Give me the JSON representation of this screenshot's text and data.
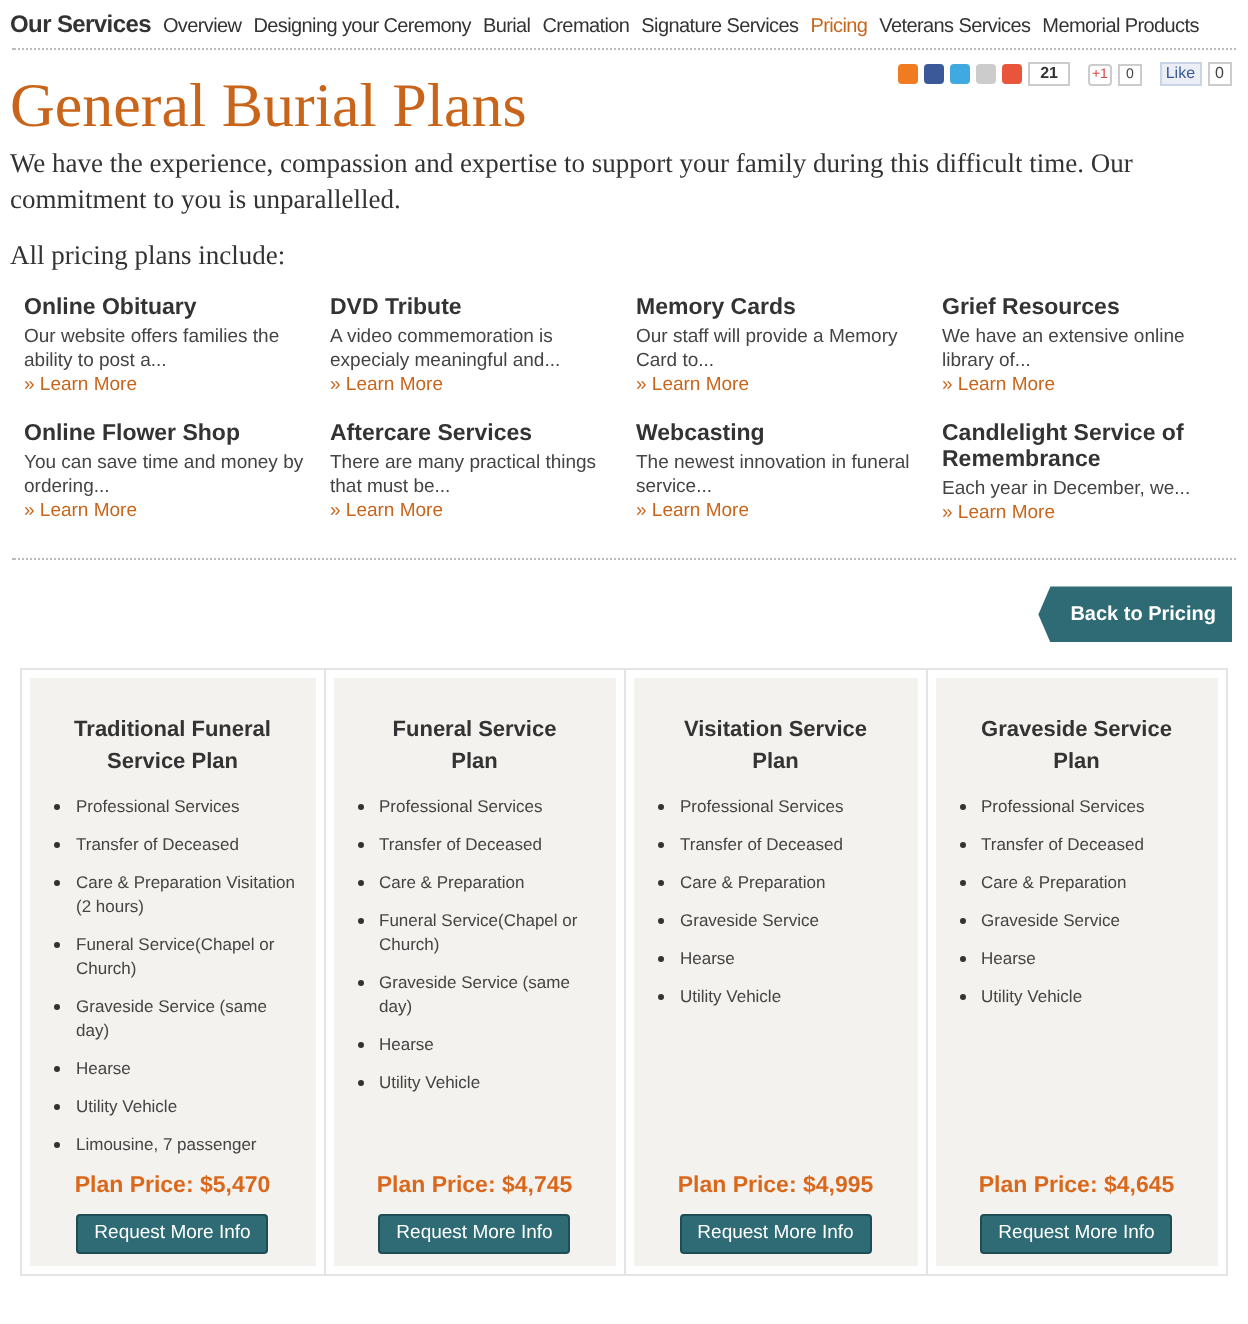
{
  "nav": {
    "title": "Our Services",
    "items": [
      {
        "label": "Overview",
        "selected": false
      },
      {
        "label": "Designing your Ceremony",
        "selected": false
      },
      {
        "label": "Burial",
        "selected": false
      },
      {
        "label": "Cremation",
        "selected": false
      },
      {
        "label": "Signature Services",
        "selected": false
      },
      {
        "label": "Pricing",
        "selected": true
      },
      {
        "label": "Veterans Services",
        "selected": false
      },
      {
        "label": "Memorial Products",
        "selected": false
      }
    ]
  },
  "share": {
    "share_count": "21",
    "plusone_label": "+1",
    "plusone_count": "0",
    "like_label": "Like",
    "like_count": "0"
  },
  "heading": "General Burial Plans",
  "intro": "We have the experience, compassion and expertise to support your family during this difficult time. Our commitment to you is unparallelled.",
  "includes_label": "All pricing plans include:",
  "features": [
    {
      "title": "Online Obituary",
      "text": "Our website offers families the ability to post a...",
      "link": "» Learn More"
    },
    {
      "title": "DVD Tribute",
      "text": "A video commemoration is expecialy meaningful and...",
      "link": "» Learn More"
    },
    {
      "title": "Memory Cards",
      "text": "Our staff will provide a Memory Card to...",
      "link": "» Learn More"
    },
    {
      "title": "Grief Resources",
      "text": "We have an extensive online library of...",
      "link": "» Learn More"
    },
    {
      "title": "Online Flower Shop",
      "text": "You can save time and money by ordering...",
      "link": "» Learn More"
    },
    {
      "title": "Aftercare Services",
      "text": "There are many practical things that must be...",
      "link": "» Learn More"
    },
    {
      "title": "Webcasting",
      "text": "The newest innovation in funeral service...",
      "link": "» Learn More"
    },
    {
      "title": "Candlelight Service of Remembrance",
      "text": "Each year in December, we...",
      "link": "» Learn More"
    }
  ],
  "back_button": "Back to Pricing",
  "plans": [
    {
      "title": "Traditional Funeral Service Plan",
      "items": [
        "Professional Services",
        "Transfer of Deceased",
        "Care & Preparation Visitation (2 hours)",
        "Funeral Service(Chapel or Church)",
        "Graveside Service (same day)",
        "Hearse",
        "Utility Vehicle",
        "Limousine, 7 passenger"
      ],
      "price": "Plan Price: $5,470",
      "button": "Request More Info"
    },
    {
      "title": "Funeral Service Plan",
      "items": [
        "Professional Services",
        "Transfer of Deceased",
        "Care & Preparation",
        "Funeral Service(Chapel or Church)",
        "Graveside Service (same day)",
        "Hearse",
        "Utility Vehicle"
      ],
      "price": "Plan Price: $4,745",
      "button": "Request More Info"
    },
    {
      "title": "Visitation Service Plan",
      "items": [
        "Professional Services",
        "Transfer of Deceased",
        "Care & Preparation",
        "Graveside Service",
        "Hearse",
        "Utility Vehicle"
      ],
      "price": "Plan Price: $4,995",
      "button": "Request More Info"
    },
    {
      "title": "Graveside Service Plan",
      "items": [
        "Professional Services",
        "Transfer of Deceased",
        "Care & Preparation",
        "Graveside Service",
        "Hearse",
        "Utility Vehicle"
      ],
      "price": "Plan Price: $4,645",
      "button": "Request More Info"
    }
  ]
}
